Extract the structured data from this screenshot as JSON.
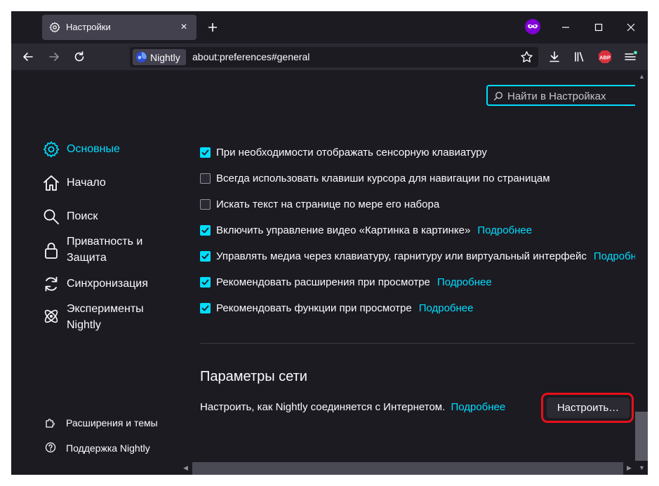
{
  "tab": {
    "title": "Настройки",
    "close": "×"
  },
  "urlbar": {
    "identity": "Nightly",
    "url": "about:preferences#general"
  },
  "search": {
    "placeholder": "Найти в Настройках"
  },
  "sidebar": {
    "items": [
      {
        "label": "Основные",
        "icon": "gear-icon",
        "selected": true
      },
      {
        "label": "Начало",
        "icon": "home-icon"
      },
      {
        "label": "Поиск",
        "icon": "search-icon"
      },
      {
        "label": "Приватность и Защита",
        "line1": "Приватность и",
        "line2": "Защита",
        "icon": "lock-icon"
      },
      {
        "label": "Синхронизация",
        "icon": "sync-icon"
      },
      {
        "label": "Эксперименты Nightly",
        "line1": "Эксперименты",
        "line2": "Nightly",
        "icon": "experiments-icon"
      }
    ],
    "bottom": [
      {
        "label": "Расширения и темы",
        "icon": "puzzle-icon"
      },
      {
        "label": "Поддержка Nightly",
        "icon": "help-icon"
      }
    ]
  },
  "options": [
    {
      "label": "При необходимости отображать сенсорную клавиатуру",
      "checked": true,
      "link": ""
    },
    {
      "label": "Всегда использовать клавиши курсора для навигации по страницам",
      "checked": false,
      "link": ""
    },
    {
      "label": "Искать текст на странице по мере его набора",
      "checked": false,
      "link": ""
    },
    {
      "label": "Включить управление видео «Картинка в картинке»",
      "checked": true,
      "link": "Подробнее"
    },
    {
      "label": "Управлять медиа через клавиатуру, гарнитуру или виртуальный интерфейс",
      "checked": true,
      "link": "Подробнее"
    },
    {
      "label": "Рекомендовать расширения при просмотре",
      "checked": true,
      "link": "Подробнее"
    },
    {
      "label": "Рекомендовать функции при просмотре",
      "checked": true,
      "link": "Подробнее"
    }
  ],
  "network": {
    "title": "Параметры сети",
    "description": "Настроить, как Nightly соединяется с Интернетом.",
    "link": "Подробнее",
    "button": "Настроить…"
  },
  "colors": {
    "accent": "#00ddff",
    "highlight": "#e8101a",
    "background": "#1c1b22"
  }
}
